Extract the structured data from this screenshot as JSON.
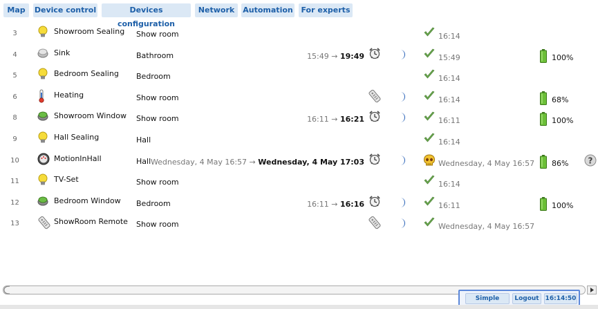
{
  "tabs": [
    {
      "label": "Map"
    },
    {
      "label": "Device control"
    },
    {
      "label": "Devices configuration"
    },
    {
      "label": "Network"
    },
    {
      "label": "Automation"
    },
    {
      "label": "For experts"
    }
  ],
  "rows": [
    {
      "num": "3",
      "icon": "bulb-icon",
      "name": "Showroom Sealing",
      "room": "Show room",
      "timer_from": "",
      "timer_to": "",
      "alarm": false,
      "moon": false,
      "status": "check-icon",
      "status_time": "16:14",
      "battery": ""
    },
    {
      "num": "4",
      "icon": "sink-sensor-icon",
      "name": "Sink",
      "room": "Bathroom",
      "timer_from": "15:49 → ",
      "timer_to": "19:49",
      "alarm": true,
      "moon": true,
      "status": "check-icon",
      "status_time": "15:49",
      "battery": "100%"
    },
    {
      "num": "5",
      "icon": "bulb-icon",
      "name": "Bedroom Sealing",
      "room": "Bedroom",
      "timer_from": "",
      "timer_to": "",
      "alarm": false,
      "moon": false,
      "status": "check-icon",
      "status_time": "16:14",
      "battery": ""
    },
    {
      "num": "6",
      "icon": "thermometer-icon",
      "name": "Heating",
      "room": "Show room",
      "timer_from": "",
      "timer_to": "",
      "alarm": "remote",
      "moon": true,
      "status": "check-icon",
      "status_time": "16:14",
      "battery": "68%"
    },
    {
      "num": "8",
      "icon": "window-sensor-icon",
      "name": "Showroom Window",
      "room": "Show room",
      "timer_from": "16:11 → ",
      "timer_to": "16:21",
      "alarm": true,
      "moon": true,
      "status": "check-icon",
      "status_time": "16:11",
      "battery": "100%"
    },
    {
      "num": "9",
      "icon": "bulb-icon",
      "name": "Hall Sealing",
      "room": "Hall",
      "timer_from": "",
      "timer_to": "",
      "alarm": false,
      "moon": false,
      "status": "check-icon",
      "status_time": "16:14",
      "battery": ""
    },
    {
      "num": "10",
      "icon": "motion-sensor-icon",
      "name": "MotionInHall",
      "room": "Hall",
      "timer_from": "Wednesday, 4 May 16:57 → ",
      "timer_to": "Wednesday, 4 May 17:03",
      "alarm": true,
      "moon": true,
      "status": "skull-icon",
      "status_time": "Wednesday, 4 May 16:57",
      "battery": "86%",
      "help": true
    },
    {
      "num": "11",
      "icon": "bulb-icon",
      "name": "TV-Set",
      "room": "Show room",
      "timer_from": "",
      "timer_to": "",
      "alarm": false,
      "moon": false,
      "status": "check-icon",
      "status_time": "16:14",
      "battery": ""
    },
    {
      "num": "12",
      "icon": "window-sensor-icon",
      "name": "Bedroom Window",
      "room": "Bedroom",
      "timer_from": "16:11 → ",
      "timer_to": "16:16",
      "alarm": true,
      "moon": true,
      "status": "check-icon",
      "status_time": "16:11",
      "battery": "100%"
    },
    {
      "num": "13",
      "icon": "remote-icon",
      "name": "ShowRoom Remote",
      "room": "Show room",
      "timer_from": "",
      "timer_to": "",
      "alarm": "remote",
      "moon": true,
      "status": "check-icon",
      "status_time": "Wednesday, 4 May 16:57",
      "battery": ""
    }
  ],
  "footer": {
    "simple_mode": "Simple mode",
    "logout": "Logout",
    "clock": "16:14:50"
  },
  "colors": {
    "tab_bg": "#dbe8f5",
    "tab_text": "#1d5fa8",
    "check": "#6aa84f",
    "battery": "#5fa830",
    "moon": "#2a63b8",
    "bulb": "#f2d230"
  }
}
